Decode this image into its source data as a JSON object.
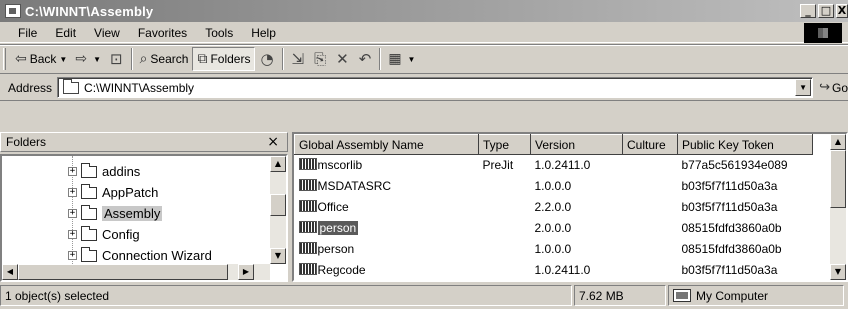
{
  "window": {
    "title": "C:\\WINNT\\Assembly",
    "controls": [
      "_",
      "□",
      "X"
    ]
  },
  "menubar": {
    "items": [
      "File",
      "Edit",
      "View",
      "Favorites",
      "Tools",
      "Help"
    ]
  },
  "toolbar": {
    "back_label": "Back",
    "search_label": "Search",
    "folders_label": "Folders",
    "icons": [
      "back-arrow-icon",
      "forward-arrow-icon",
      "up-folder-icon",
      "search-icon",
      "folders-icon",
      "history-icon",
      "move-to-icon",
      "copy-to-icon",
      "delete-icon",
      "undo-icon",
      "views-icon"
    ]
  },
  "addressbar": {
    "label": "Address",
    "value": "C:\\WINNT\\Assembly",
    "go_label": "Go"
  },
  "folders_pane": {
    "title": "Folders",
    "close": "×",
    "items": [
      {
        "label": "addins",
        "expander": "+",
        "selected": false
      },
      {
        "label": "AppPatch",
        "expander": "+",
        "selected": false
      },
      {
        "label": "Assembly",
        "expander": "+",
        "selected": true
      },
      {
        "label": "Config",
        "expander": "+",
        "selected": false
      },
      {
        "label": "Connection Wizard",
        "expander": "+",
        "selected": false
      }
    ]
  },
  "list_pane": {
    "columns": [
      "Global Assembly Name",
      "Type",
      "Version",
      "Culture",
      "Public Key Token"
    ],
    "rows": [
      {
        "name": "mscorlib",
        "type": "PreJit",
        "version": "1.0.2411.0",
        "culture": "",
        "token": "b77a5c561934e089",
        "selected": false
      },
      {
        "name": "MSDATASRC",
        "type": "",
        "version": "1.0.0.0",
        "culture": "",
        "token": "b03f5f7f11d50a3a",
        "selected": false
      },
      {
        "name": "Office",
        "type": "",
        "version": "2.2.0.0",
        "culture": "",
        "token": "b03f5f7f11d50a3a",
        "selected": false
      },
      {
        "name": "person",
        "type": "",
        "version": "2.0.0.0",
        "culture": "",
        "token": "08515fdfd3860a0b",
        "selected": true
      },
      {
        "name": "person",
        "type": "",
        "version": "1.0.0.0",
        "culture": "",
        "token": "08515fdfd3860a0b",
        "selected": false
      },
      {
        "name": "Regcode",
        "type": "",
        "version": "1.0.2411.0",
        "culture": "",
        "token": "b03f5f7f11d50a3a",
        "selected": false
      }
    ]
  },
  "statusbar": {
    "selection": "1 object(s) selected",
    "size": "7.62 MB",
    "zone": "My Computer"
  }
}
